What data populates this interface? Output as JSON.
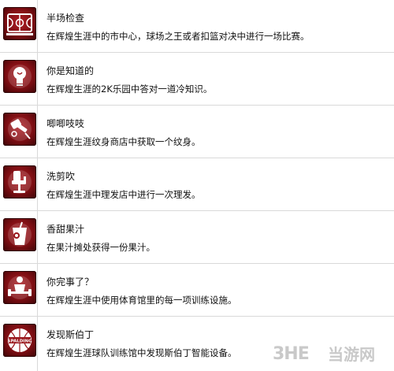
{
  "achievements": [
    {
      "icon": "basketball-court-icon",
      "title": "半场检查",
      "description": "在辉煌生涯中的市中心，球场之王或者扣篮对决中进行一场比赛。"
    },
    {
      "icon": "light-bulb-icon",
      "title": "你是知道的",
      "description": "在辉煌生涯的2K乐园中答对一道冷知识。"
    },
    {
      "icon": "tattoo-machine-icon",
      "title": "唧唧吱吱",
      "description": "在辉煌生涯纹身商店中获取一个纹身。"
    },
    {
      "icon": "barber-chair-icon",
      "title": "洗剪吹",
      "description": "在辉煌生涯中理发店中进行一次理发。"
    },
    {
      "icon": "juice-cup-icon",
      "title": "香甜果汁",
      "description": "在果汁摊处获得一份果汁。"
    },
    {
      "icon": "dumbbell-icon",
      "title": "你完事了？",
      "description": "在辉煌生涯中使用体育馆里的每一项训练设施。"
    },
    {
      "icon": "spalding-ball-icon",
      "title": "发现斯伯丁",
      "description": "在辉煌生涯球队训练馆中发现斯伯丁智能设备。",
      "icon_text": "SPALDING"
    }
  ],
  "watermark": {
    "logo": "3HE",
    "text": "当游网"
  },
  "colors": {
    "badge": "#9a161c",
    "divider": "#d9d9d9",
    "text": "#111111",
    "watermark": "#c9c9c9"
  }
}
